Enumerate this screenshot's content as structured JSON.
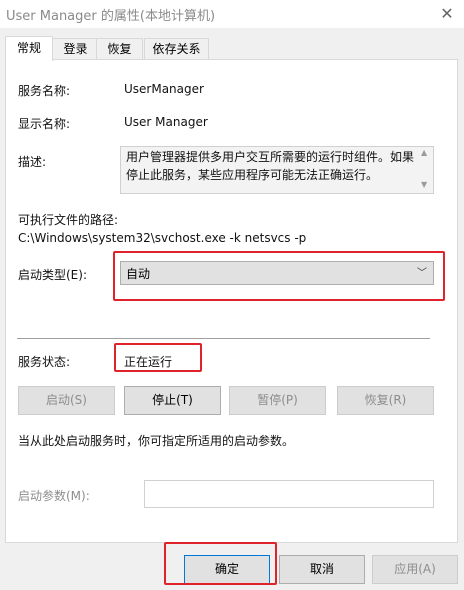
{
  "window": {
    "title": "User Manager 的属性(本地计算机)",
    "close_glyph": "✕"
  },
  "tabs": [
    {
      "label": "常规",
      "active": true
    },
    {
      "label": "登录",
      "active": false
    },
    {
      "label": "恢复",
      "active": false
    },
    {
      "label": "依存关系",
      "active": false
    }
  ],
  "general": {
    "service_name_label": "服务名称:",
    "service_name_value": "UserManager",
    "display_name_label": "显示名称:",
    "display_name_value": "User Manager",
    "description_label": "描述:",
    "description_value": "用户管理器提供多用户交互所需要的运行时组件。如果停止此服务，某些应用程序可能无法正确运行。",
    "exe_path_label": "可执行文件的路径:",
    "exe_path_value": "C:\\Windows\\system32\\svchost.exe -k netsvcs -p",
    "startup_type_label": "启动类型(E):",
    "startup_type_value": "自动",
    "service_status_label": "服务状态:",
    "service_status_value": "正在运行",
    "control_buttons": {
      "start": "启动(S)",
      "stop": "停止(T)",
      "pause": "暂停(P)",
      "resume": "恢复(R)"
    },
    "hint_text": "当从此处启动服务时，你可指定所适用的启动参数。",
    "start_params_label": "启动参数(M):",
    "start_params_value": ""
  },
  "footer": {
    "ok": "确定",
    "cancel": "取消",
    "apply": "应用(A)"
  },
  "colors": {
    "highlight": "#e0232a",
    "accent": "#0078d7"
  }
}
